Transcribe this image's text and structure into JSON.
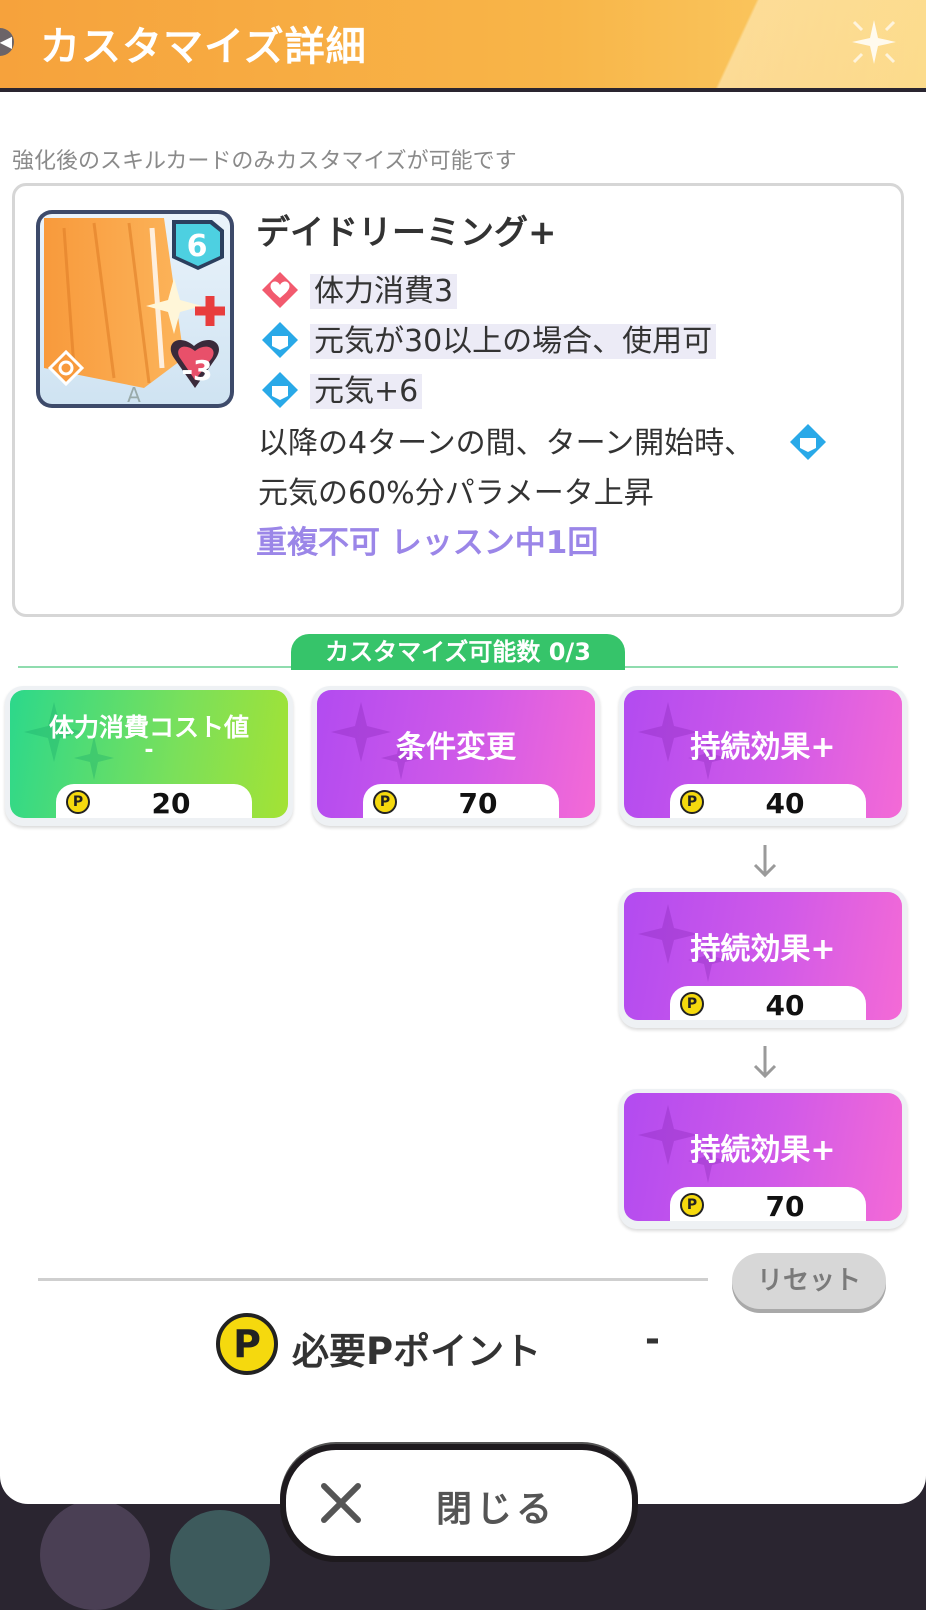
{
  "header": {
    "title": "カスタマイズ詳細"
  },
  "hint": "強化後のスキルカードのみカスタマイズが可能です",
  "card": {
    "name": "デイドリーミング+",
    "cost_badge": "6",
    "heart_badge": "-3",
    "rank_letter": "A",
    "effects": [
      {
        "icon": "heart-icon",
        "text": "体力消費3"
      },
      {
        "icon": "genki-icon",
        "text": "元気が30以上の場合、使用可"
      },
      {
        "icon": "genki-icon",
        "text": "元気+6"
      }
    ],
    "effect_line_1": "以降の4ターンの間、ターン開始時、",
    "effect_line_2": "元気の60%分パラメータ上昇",
    "note": "重複不可 レッスン中1回"
  },
  "customize_count": "カスタマイズ可能数 0/3",
  "options": [
    {
      "label_1": "体力消費コスト値",
      "label_2": "-",
      "cost": "20",
      "color": "#2cd88b"
    },
    {
      "label_1": "条件変更",
      "cost": "70",
      "color": "#d15ae8"
    },
    {
      "label_1": "持続効果+",
      "cost": "40",
      "color": "#d15ae8"
    },
    {
      "label_1": "持続効果+",
      "cost": "40",
      "color": "#d15ae8"
    },
    {
      "label_1": "持続効果+",
      "cost": "70",
      "color": "#d15ae8"
    }
  ],
  "coin_letter": "P",
  "reset_label": "リセット",
  "required": {
    "label": "必要Pポイント",
    "value": "-"
  },
  "close_label": "閉じる"
}
